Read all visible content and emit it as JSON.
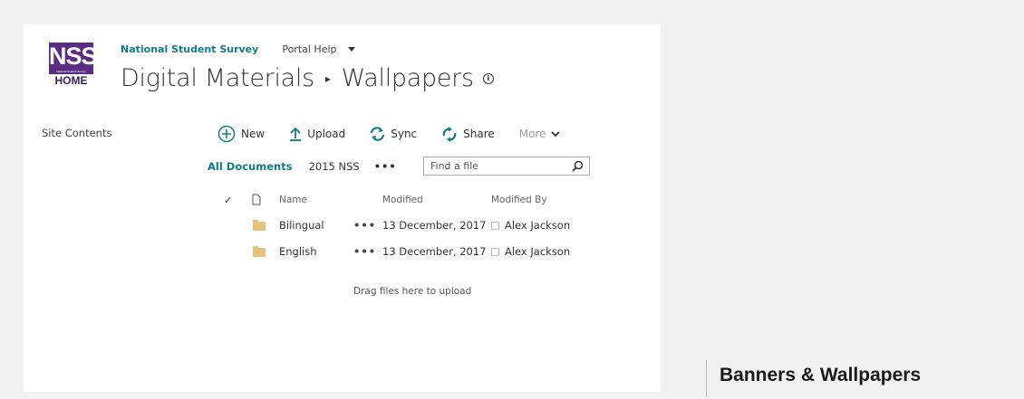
{
  "logo": {
    "text": "NSS",
    "subtext": "National Student Survey",
    "home": "HOME"
  },
  "topnav": {
    "site_link": "National Student Survey",
    "help_link": "Portal Help"
  },
  "breadcrumb": {
    "parent": "Digital Materials",
    "separator": "▸",
    "current": "Wallpapers",
    "info_icon": "i"
  },
  "quicklaunch": {
    "site_contents": "Site Contents"
  },
  "commands": {
    "new": "New",
    "upload": "Upload",
    "sync": "Sync",
    "share": "Share",
    "more": "More"
  },
  "views": {
    "all_documents": "All Documents",
    "custom_view": "2015 NSS",
    "ellipsis": "•••"
  },
  "search": {
    "placeholder": "Find a file"
  },
  "list": {
    "columns": {
      "check": "✓",
      "name": "Name",
      "modified": "Modified",
      "modified_by": "Modified By"
    },
    "rows": [
      {
        "name": "Bilingual",
        "menu": "•••",
        "modified": "13 December, 2017",
        "modified_by": "Alex Jackson"
      },
      {
        "name": "English",
        "menu": "•••",
        "modified": "13 December, 2017",
        "modified_by": "Alex Jackson"
      }
    ]
  },
  "drag_hint": "Drag files here to upload",
  "caption": "Banners & Wallpapers",
  "colors": {
    "accent": "#0f7c85",
    "brand": "#5a2d82",
    "folder": "#e6c27a"
  },
  "icons": {
    "new": "plus-circle-icon",
    "upload": "upload-arrow-icon",
    "sync": "sync-icon",
    "share": "share-icon",
    "more": "chevron-down-icon",
    "search": "search-icon",
    "folder": "folder-icon",
    "document": "document-icon",
    "presence": "presence-icon"
  }
}
